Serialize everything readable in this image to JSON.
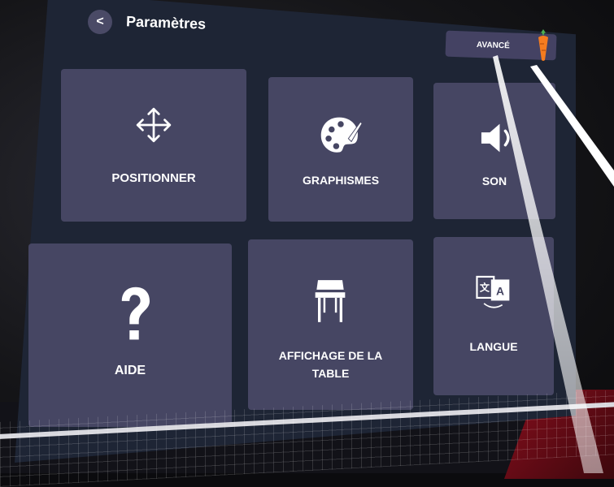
{
  "header": {
    "title": "Paramètres",
    "back_icon": "chevron-left-icon",
    "advanced_label": "AVANCÉ"
  },
  "tiles": [
    {
      "label": "POSITIONNER",
      "icon": "move-arrows-icon"
    },
    {
      "label": "GRAPHISMES",
      "icon": "palette-icon"
    },
    {
      "label": "SON",
      "icon": "speaker-icon"
    },
    {
      "label": "AIDE",
      "icon": "question-mark-icon"
    },
    {
      "label": "AFFICHAGE DE LA TABLE",
      "icon": "table-icon"
    },
    {
      "label": "LANGUE",
      "icon": "translate-icon"
    }
  ],
  "colors": {
    "panel": "#1e2535",
    "tile": "#464663",
    "button": "#444263",
    "table_accent": "#7a0d1a"
  }
}
